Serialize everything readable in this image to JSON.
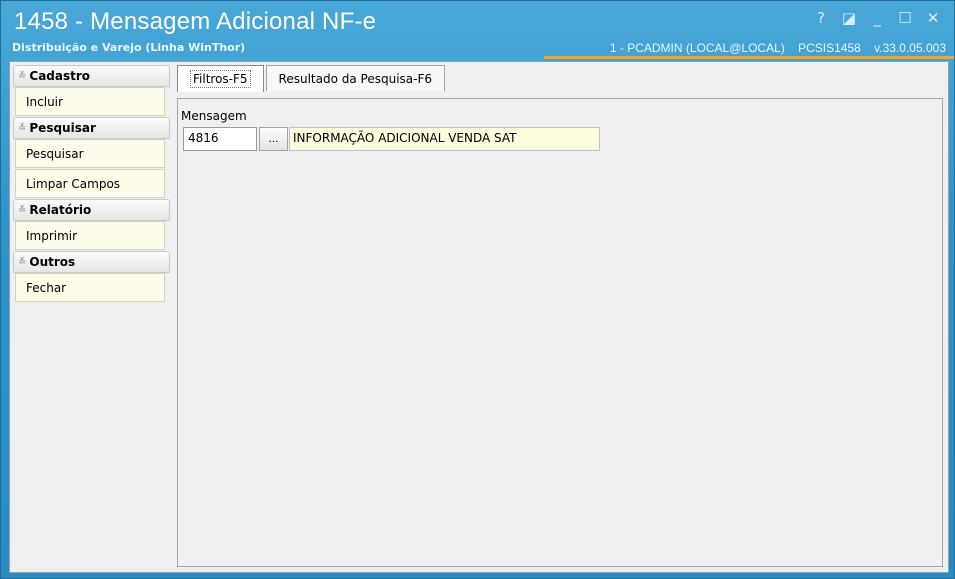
{
  "window": {
    "title": "1458 - Mensagem Adicional NF-e",
    "subtitle": "Distribuição e Varejo (Linha WinThor)",
    "status_user": "1 - PCADMIN (LOCAL@LOCAL)",
    "status_program": "PCSIS1458",
    "status_version": "v.33.0.05.003",
    "controls": {
      "help": "?",
      "restore_alt": "◪",
      "minimize": "_",
      "maximize": "☐",
      "close": "✕"
    }
  },
  "sidebar": {
    "groups": [
      {
        "title": "Cadastro",
        "items": [
          "Incluir"
        ]
      },
      {
        "title": "Pesquisar",
        "items": [
          "Pesquisar",
          "Limpar Campos"
        ]
      },
      {
        "title": "Relatório",
        "items": [
          "Imprimir"
        ]
      },
      {
        "title": "Outros",
        "items": [
          "Fechar"
        ]
      }
    ]
  },
  "tabs": [
    {
      "label": "Filtros-F5",
      "active": true
    },
    {
      "label": "Resultado da Pesquisa-F6",
      "active": false
    }
  ],
  "filters": {
    "mensagem_label": "Mensagem",
    "mensagem_code": "4816",
    "lookup_label": "...",
    "mensagem_desc": "INFORMAÇÃO ADICIONAL VENDA SAT"
  }
}
